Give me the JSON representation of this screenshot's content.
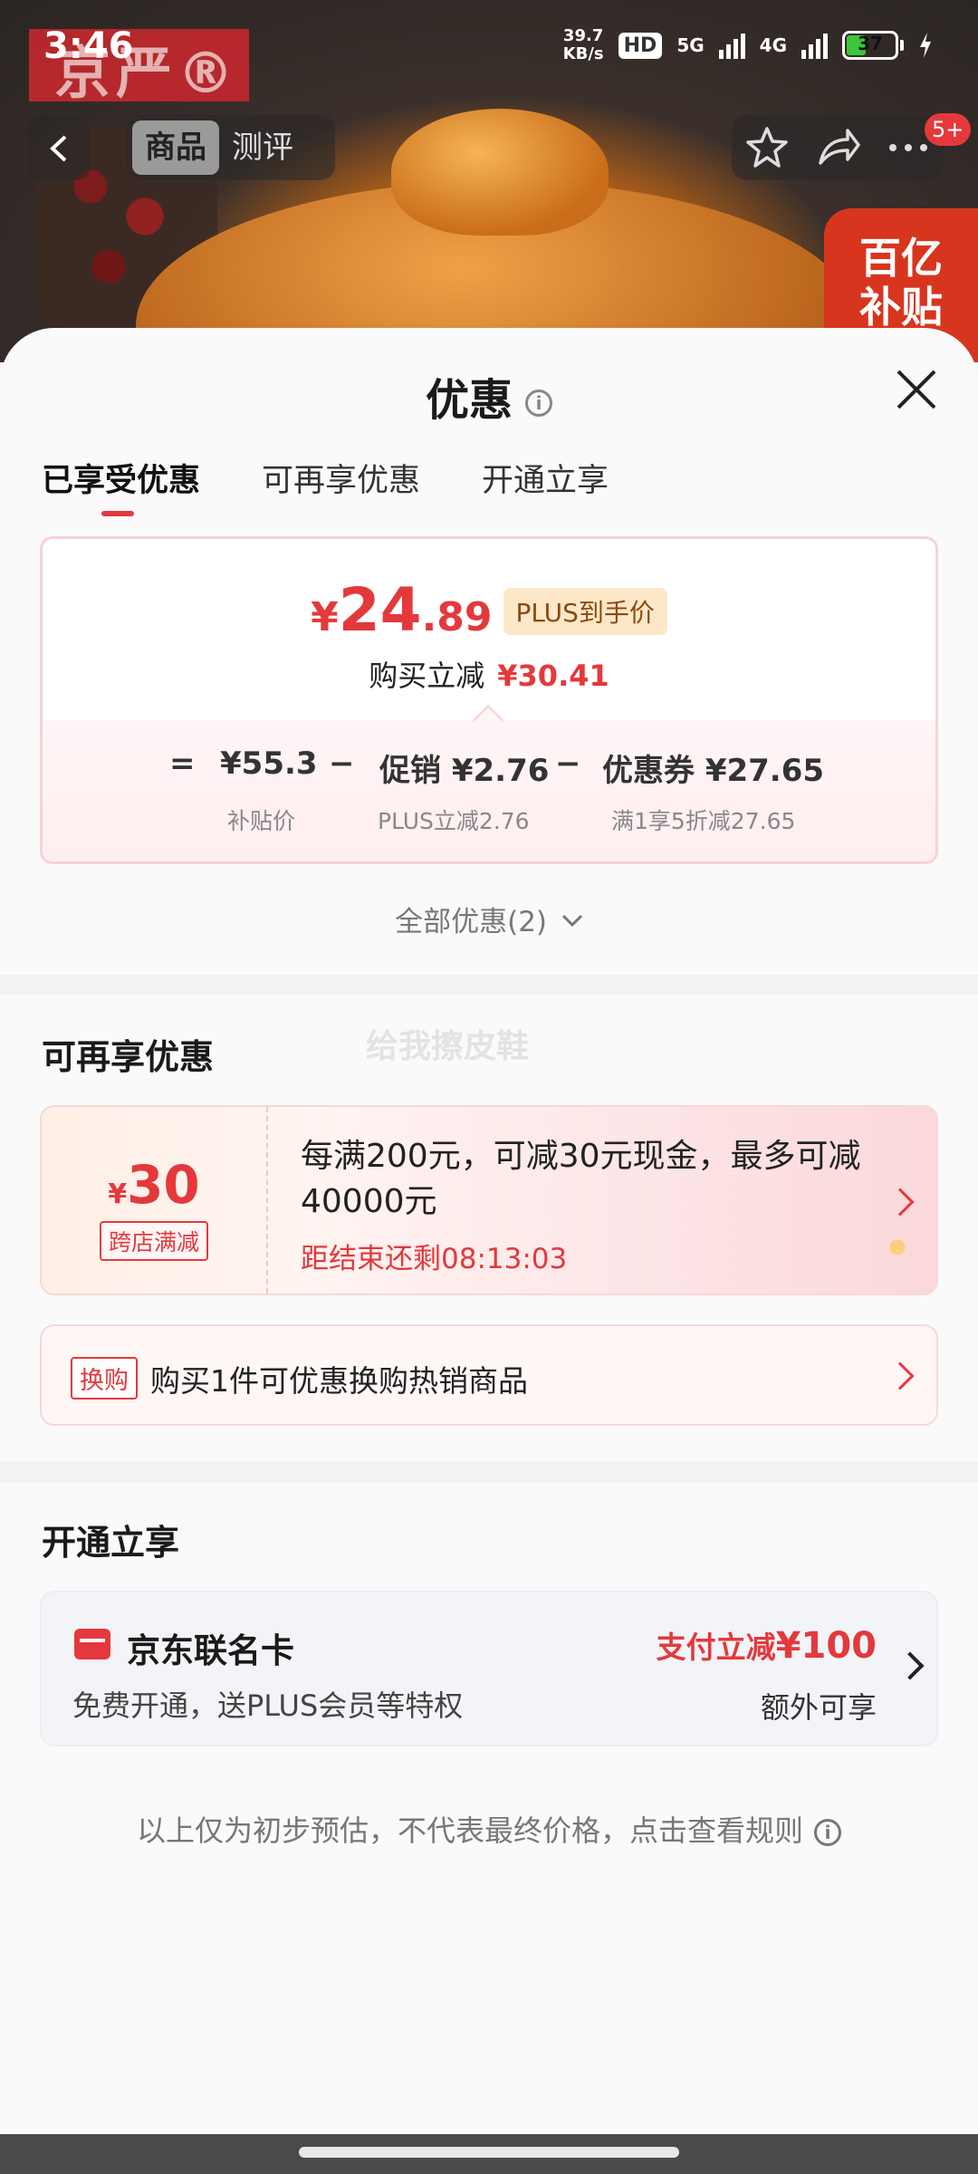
{
  "status_bar": {
    "time": "3:46",
    "net_speed_value": "39.7",
    "net_speed_unit": "KB/s",
    "hd": "HD",
    "network_5g": "5G",
    "network_4g": "4G",
    "battery": "37"
  },
  "hero": {
    "brand": "京严®",
    "subsidy_line1": "百亿",
    "subsidy_line2": "补贴"
  },
  "nav": {
    "tabs": [
      {
        "label": "商品",
        "active": true
      },
      {
        "label": "测评",
        "active": false
      }
    ],
    "badge": "5+"
  },
  "sheet": {
    "title": "优惠",
    "tabs": [
      {
        "label": "已享受优惠",
        "active": true
      },
      {
        "label": "可再享优惠",
        "active": false
      },
      {
        "label": "开通立享",
        "active": false
      }
    ]
  },
  "price_card": {
    "currency": "¥",
    "final_price_int": "24",
    "final_price_dec": ".89",
    "plus_tag": "PLUS到手价",
    "saving_label": "购买立减",
    "saving_amount": "¥30.41",
    "formula": {
      "equals": "=",
      "base": "¥55.3",
      "minus1": "−",
      "promo": "促销 ¥2.76",
      "minus2": "−",
      "coupon": "优惠券 ¥27.65"
    },
    "formula_labels": {
      "base": "补贴价",
      "promo": "PLUS立减2.76",
      "coupon": "满1享5折减27.65"
    }
  },
  "all_offers": "全部优惠(2)",
  "more_offers": {
    "title": "可再享优惠",
    "watermark": "给我擦皮鞋",
    "promo": {
      "currency": "¥",
      "amount": "30",
      "tag": "跨店满减",
      "text": "每满200元，可减30元现金，最多可减40000元",
      "countdown": "距结束还剩08:13:03"
    },
    "swap": {
      "tag": "换购",
      "text": "购买1件可优惠换购热销商品"
    }
  },
  "open_now": {
    "title": "开通立享",
    "card_name": "京东联名卡",
    "card_desc": "免费开通，送PLUS会员等特权",
    "benefit_prefix": "支付立减",
    "benefit_amount": "¥100",
    "extra": "额外可享"
  },
  "footer_note": "以上仅为初步预估，不代表最终价格，点击查看规则",
  "colors": {
    "accent": "#e4393c",
    "plus_tag_bg": "#fce8c8",
    "sheet_bg": "#fafafb"
  }
}
